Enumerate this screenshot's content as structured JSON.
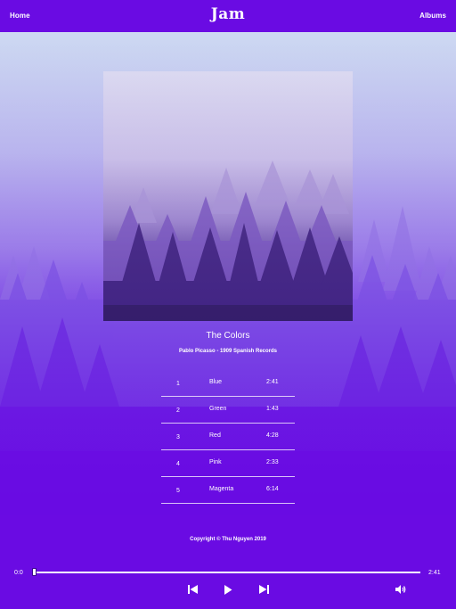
{
  "header": {
    "home_label": "Home",
    "brand": "Jam",
    "albums_label": "Albums"
  },
  "album": {
    "title": "The Colors",
    "artist": "Pablo Picasso - 1909 Spanish Records",
    "tracks": [
      {
        "number": "1",
        "name": "Blue",
        "duration": "2:41"
      },
      {
        "number": "2",
        "name": "Green",
        "duration": "1:43"
      },
      {
        "number": "3",
        "name": "Red",
        "duration": "4:28"
      },
      {
        "number": "4",
        "name": "Pink",
        "duration": "2:33"
      },
      {
        "number": "5",
        "name": "Magenta",
        "duration": "6:14"
      }
    ]
  },
  "footer": {
    "copyright": "Copyright © Thu Nguyen 2019"
  },
  "player": {
    "current_time": "0:0",
    "total_time": "2:41",
    "progress": 0,
    "icons": [
      "skip-previous-icon",
      "play-icon",
      "skip-next-icon",
      "volume-icon"
    ]
  },
  "colors": {
    "brand_purple": "#6a0be3",
    "text": "#ffffff"
  }
}
